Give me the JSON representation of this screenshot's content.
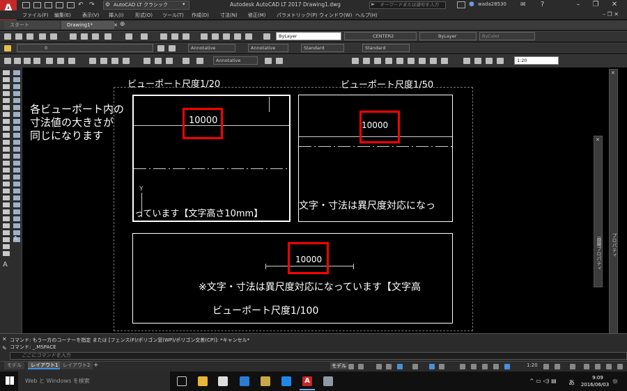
{
  "app": {
    "logo_letter": "A",
    "logo_sub": "LT",
    "workspace": "AutoCAD LT クラシック",
    "window_title": "Autodesk AutoCAD LT 2017   Drawing1.dwg",
    "search_placeholder": "キーワードまたは語句を入力",
    "user": "wada28530"
  },
  "menu": [
    "ファイル(F)",
    "編集(E)",
    "表示(V)",
    "挿入(I)",
    "形式(O)",
    "ツール(T)",
    "作成(D)",
    "寸法(N)",
    "修正(M)",
    "パラメトリック(P)",
    "ウィンドウ(W)",
    "ヘルプ(H)"
  ],
  "tabs": {
    "start": "スタート",
    "drawing": "Drawing1*"
  },
  "toolbar": {
    "layer_value": "0",
    "color": "ByLayer",
    "linetype": "CENTER2",
    "lineweight": "ByLayer",
    "plotstyle": "ByColor",
    "annotative_text": "Annotative",
    "annotative_dim": "Annotative",
    "table_style": "Standard",
    "multileader_style": "Standard",
    "annotative_mleader": "Annotative",
    "viewport_scale": "1:20"
  },
  "canvas": {
    "left_note_lines": [
      "各ビューポート内の",
      "寸法値の大きさが",
      "同じになります"
    ],
    "vp1_title": "ビューポート尺度1/20",
    "vp2_title": "ビューポート尺度1/50",
    "vp1_dim": "10000",
    "vp2_dim": "10000",
    "vp3_dim": "10000",
    "vp1_text": "っています【文字高さ10mm】",
    "vp2_text": "文字・寸法は異尺度対応になっ",
    "vp3_text": "※文字・寸法は異尺度対応になっています【文字高",
    "vp3_title": "ビューポート尺度1/100",
    "ucs_y": "Y"
  },
  "palettes": {
    "prop_label_1": "画層プロパティ",
    "prop_label_2": "プロパティ"
  },
  "command": {
    "history": [
      "コマンド: もう一方のコーナーを指定 または [フェンス(F)/ポリゴン窓(WP)/ポリゴン交差(CP)]: *キャンセル*",
      "コマンド: _.MSPACE"
    ],
    "input_placeholder": "ここにコマンドを入力"
  },
  "layout_tabs": [
    "モデル",
    "レイアウト1",
    "レイアウト2"
  ],
  "status": {
    "model_label": "モデル",
    "scale": "1:20"
  },
  "taskbar": {
    "search": "Web と Windows を検索",
    "time": "9:09",
    "date": "2016/06/03",
    "ime": "あ"
  },
  "colors": {
    "accent_red": "#ff0000",
    "logo_red": "#c62828"
  }
}
